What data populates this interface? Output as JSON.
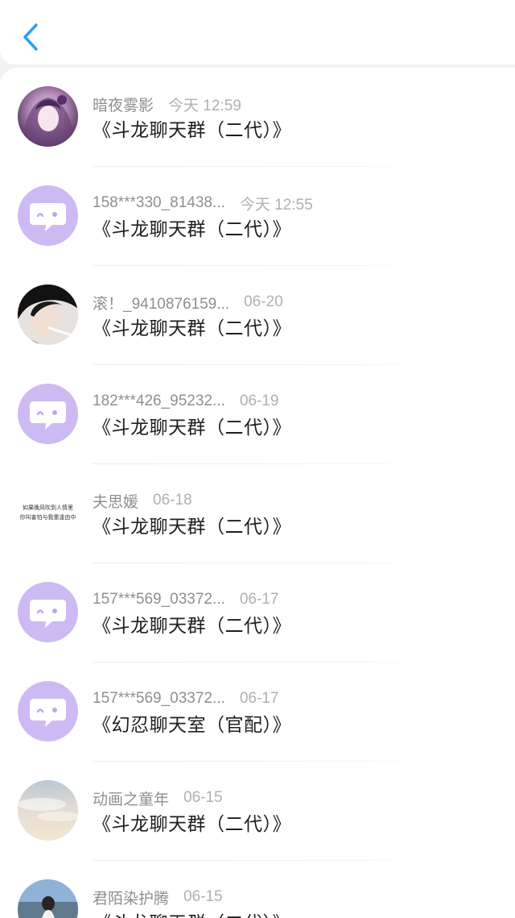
{
  "header": {
    "back_icon": "chevron-left-icon",
    "accent": "#2d9ff0"
  },
  "items": [
    {
      "name": "暗夜雾影",
      "time": "今天 12:59",
      "title": "《斗龙聊天群（二代）》",
      "avatar": "photo-anime"
    },
    {
      "name": "158***330_81438...",
      "time": "今天 12:55",
      "title": "《斗龙聊天群（二代）》",
      "avatar": "default-chat"
    },
    {
      "name": "滚！_9410876159...",
      "time": "06-20",
      "title": "《斗龙聊天群（二代）》",
      "avatar": "photo-portrait"
    },
    {
      "name": "182***426_95232...",
      "time": "06-19",
      "title": "《斗龙聊天群（二代）》",
      "avatar": "default-chat"
    },
    {
      "name": "夫思媛",
      "time": "06-18",
      "title": "《斗龙聊天群（二代）》",
      "avatar": "text-calligraphy",
      "avatar_text": [
        "如果晚风吹到人情里",
        "你叫害怕与我重逢由中"
      ]
    },
    {
      "name": "157***569_03372...",
      "time": "06-17",
      "title": "《斗龙聊天群（二代）》",
      "avatar": "default-chat"
    },
    {
      "name": "157***569_03372...",
      "time": "06-17",
      "title": "《幻忍聊天室（官配）》",
      "avatar": "default-chat"
    },
    {
      "name": "动画之童年",
      "time": "06-15",
      "title": "《斗龙聊天群（二代）》",
      "avatar": "photo-sky"
    },
    {
      "name": "君陌染护腾",
      "time": "06-15",
      "title": "《斗龙聊天群（二代）》",
      "avatar": "photo-figure"
    }
  ],
  "colors": {
    "default_avatar": "#cdbaf3",
    "name_text": "#8f8f8f",
    "time_text": "#b0b0b0",
    "title_text": "#1f1f1f"
  }
}
